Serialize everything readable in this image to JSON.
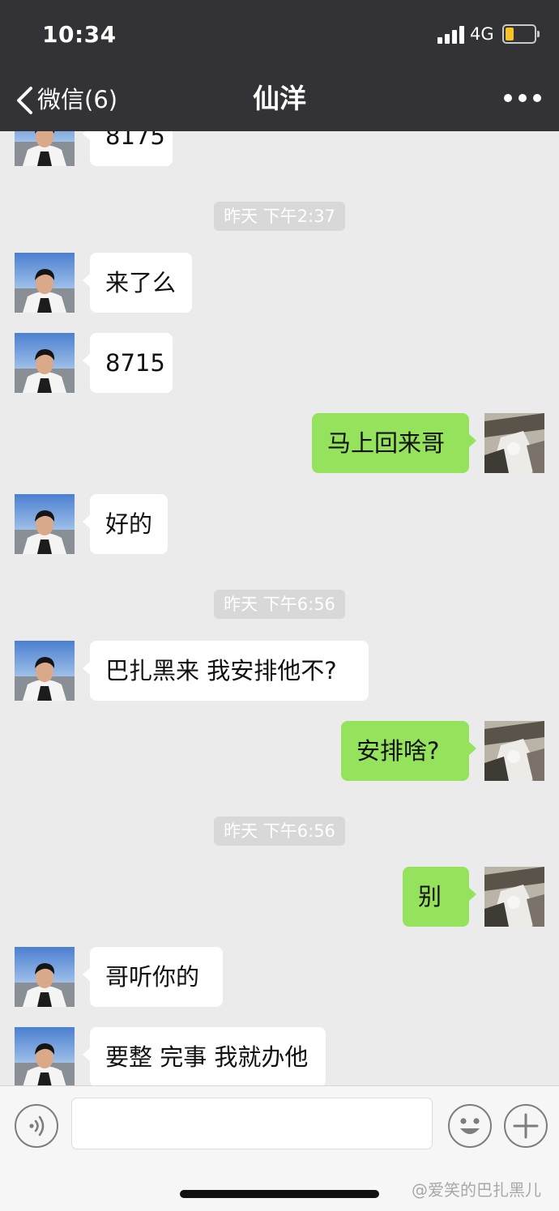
{
  "status_bar": {
    "time": "10:34",
    "network": "4G"
  },
  "nav": {
    "back_label": "微信(6)",
    "title": "仙洋"
  },
  "messages": [
    {
      "side": "left",
      "text": "8175"
    },
    {
      "type": "time",
      "text": "昨天 下午2:37"
    },
    {
      "side": "left",
      "text": "来了么"
    },
    {
      "side": "left",
      "text": "8715"
    },
    {
      "side": "right",
      "text": "马上回来哥"
    },
    {
      "side": "left",
      "text": "好的"
    },
    {
      "type": "time",
      "text": "昨天 下午6:56"
    },
    {
      "side": "left",
      "text": "巴扎黑来 我安排他不?"
    },
    {
      "side": "right",
      "text": "安排啥?"
    },
    {
      "type": "time",
      "text": "昨天 下午6:56"
    },
    {
      "side": "right",
      "text": "别"
    },
    {
      "side": "left",
      "text": "哥听你的"
    },
    {
      "side": "left",
      "text": "要整 完事 我就办他"
    }
  ],
  "input_bar": {
    "text_value": ""
  },
  "watermark": "@爱笑的巴扎黑儿",
  "icons": {
    "back": "chevron-left-icon",
    "more": "more-dots-icon",
    "voice": "voice-icon",
    "emoji": "emoji-icon",
    "plus": "plus-icon"
  },
  "colors": {
    "header_bg": "#333236",
    "chat_bg": "#ebebeb",
    "sent_bubble": "#95e35c",
    "received_bubble": "#ffffff",
    "battery": "#f7c32b"
  }
}
